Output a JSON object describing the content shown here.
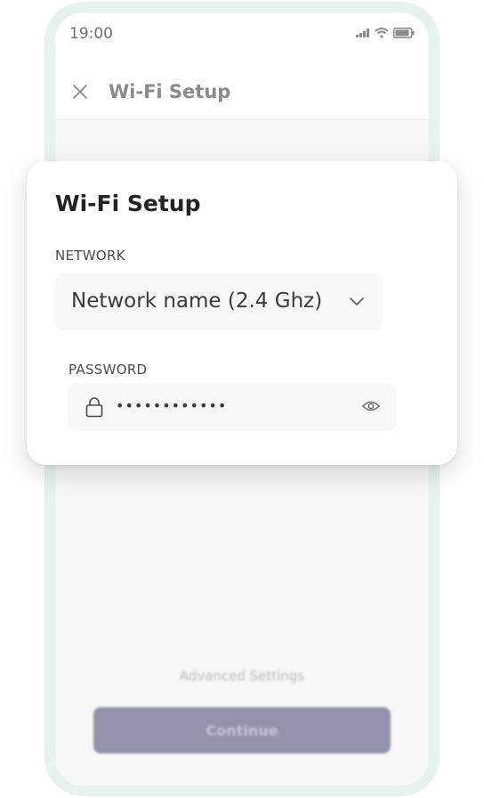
{
  "status_bar": {
    "time": "19:00"
  },
  "header": {
    "title": "Wi-Fi Setup"
  },
  "card": {
    "title": "Wi-Fi Setup",
    "network_label": "NETWORK",
    "network_value": "Network name (2.4 Ghz)",
    "password_label": "PASSWORD",
    "password_value": "••••••••••••"
  },
  "footer": {
    "advanced_settings_label": "Advanced Settings",
    "continue_label": "Continue"
  },
  "icons": {
    "close": "close-icon",
    "signal": "signal-icon",
    "wifi": "wifi-icon",
    "battery": "battery-icon",
    "chevron": "chevron-down-icon",
    "lock": "lock-icon",
    "eye": "eye-icon"
  },
  "colors": {
    "frame": "#e6f2ef",
    "continue_button": "#9394ab",
    "field_background": "#f8f8f8"
  }
}
